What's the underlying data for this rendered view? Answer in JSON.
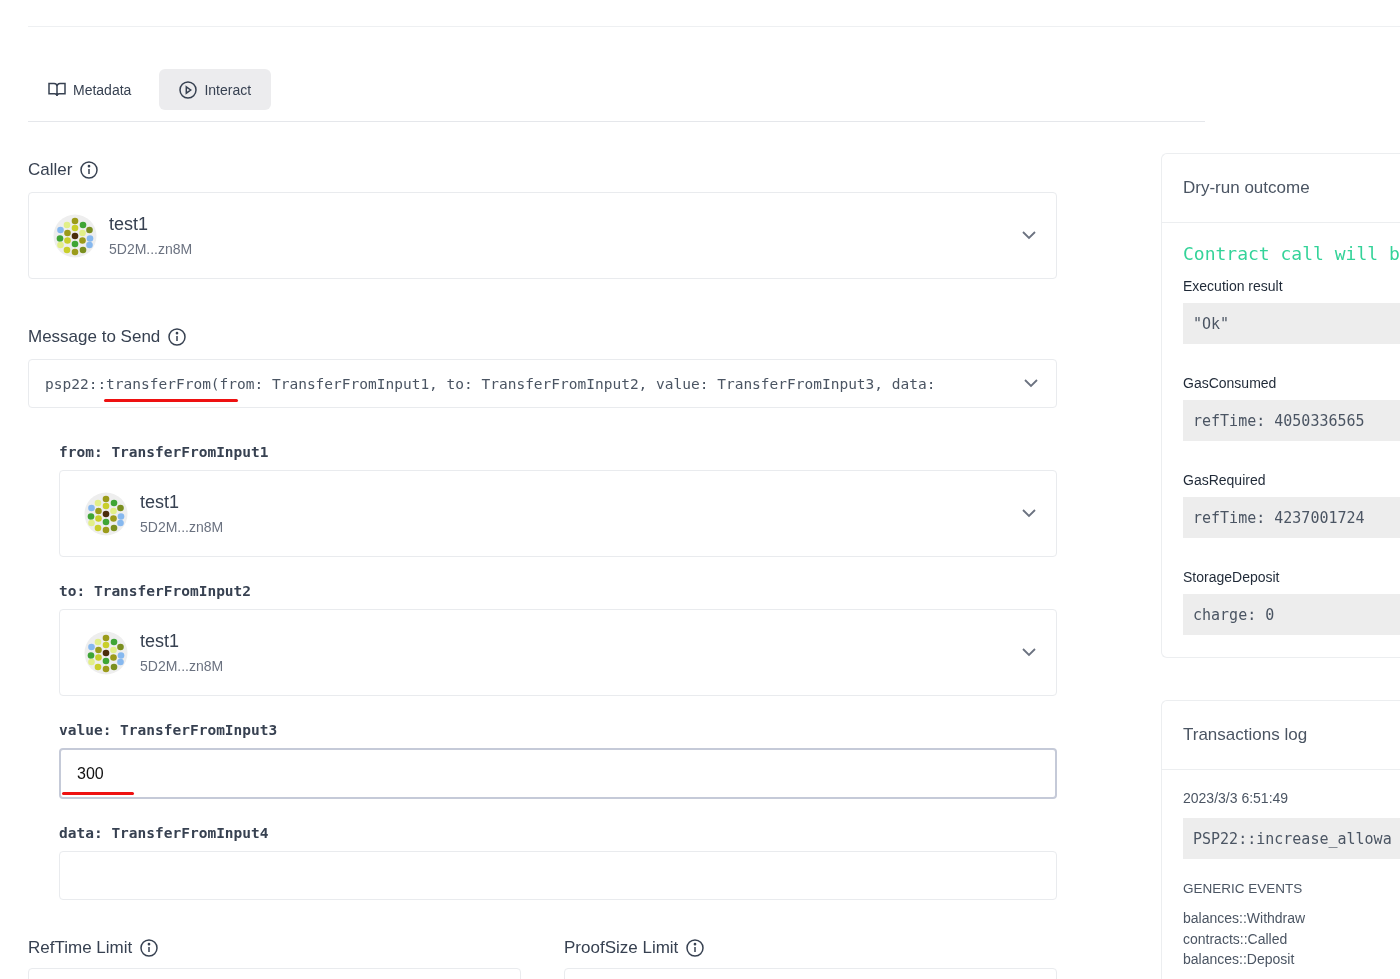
{
  "tabs": [
    {
      "label": "Metadata",
      "kind": "book",
      "selected": false
    },
    {
      "label": "Interact",
      "kind": "play",
      "selected": true
    }
  ],
  "caller": {
    "label": "Caller",
    "account": {
      "name": "test1",
      "address": "5D2M...zn8M"
    }
  },
  "message": {
    "label": "Message to Send",
    "value": "psp22::transferFrom(from: TransferFromInput1, to: TransferFromInput2, value: TransferFromInput3, data:",
    "marked": true
  },
  "args": [
    {
      "label": "from: TransferFromInput1",
      "kind": "account",
      "account": {
        "name": "test1",
        "address": "5D2M...zn8M"
      }
    },
    {
      "label": "to: TransferFromInput2",
      "kind": "account",
      "account": {
        "name": "test1",
        "address": "5D2M...zn8M"
      }
    },
    {
      "label": "value: TransferFromInput3",
      "kind": "text",
      "value": "300",
      "focused": true,
      "marked": true
    },
    {
      "label": "data: TransferFromInput4",
      "kind": "text",
      "focused": false,
      "marked": false
    }
  ],
  "limits": [
    {
      "label": "RefTime Limit"
    },
    {
      "label": "ProofSize Limit"
    }
  ],
  "dry_run": {
    "title": "Dry-run outcome",
    "status": "Contract call will b",
    "fields": [
      {
        "label": "Execution result",
        "value": "\"Ok\""
      },
      {
        "label": "GasConsumed",
        "value": "refTime: 4050336565"
      },
      {
        "label": "GasRequired",
        "value": "refTime: 4237001724"
      },
      {
        "label": "StorageDeposit",
        "value": "charge: 0"
      }
    ]
  },
  "transactions": {
    "title": "Transactions log",
    "entries": [
      {
        "time": "2023/3/3 6:51:49",
        "message": "PSP22::increase_allowa",
        "events_heading": "GENERIC EVENTS",
        "events": [
          "balances::Withdraw",
          "contracts::Called",
          "balances::Deposit"
        ]
      }
    ]
  }
}
